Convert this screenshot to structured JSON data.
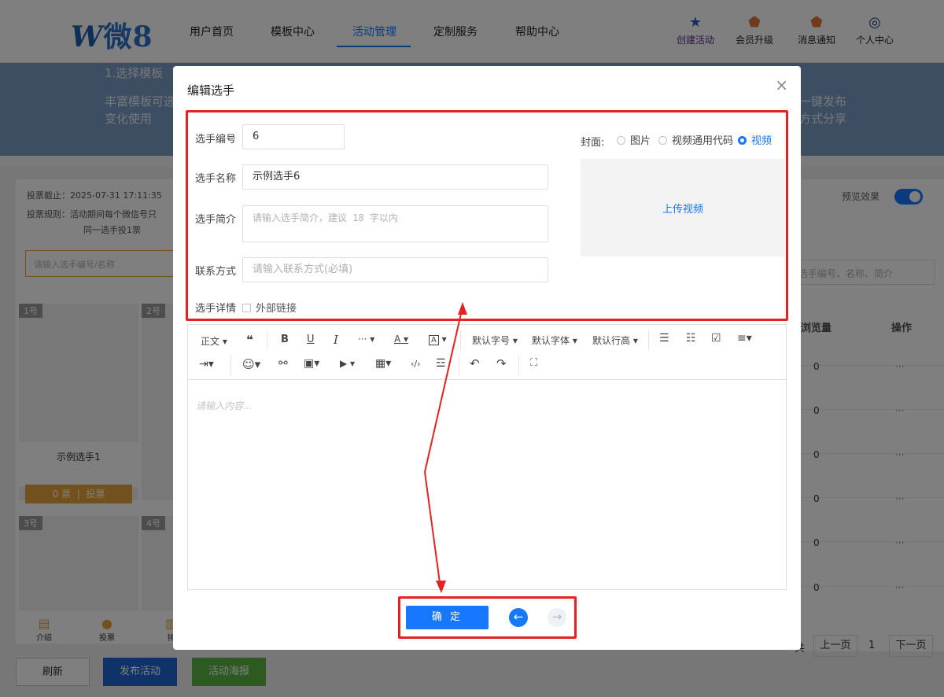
{
  "header": {
    "logo_w": "W",
    "logo_text": "微8",
    "nav": [
      "用户首页",
      "模板中心",
      "活动管理",
      "定制服务",
      "帮助中心"
    ],
    "active_nav": "活动管理",
    "actions": [
      {
        "label": "创建活动",
        "icon": "star-icon"
      },
      {
        "label": "会员升级",
        "icon": "shield-icon"
      },
      {
        "label": "消息通知",
        "icon": "bell-icon"
      },
      {
        "label": "个人中心",
        "icon": "user-icon"
      }
    ]
  },
  "banner": {
    "step1_title": "1.选择模板",
    "step1_desc1": "丰富模板可选",
    "step1_desc2": "变化使用",
    "step4_desc1": "一键发布",
    "step4_desc2": "方式分享"
  },
  "left": {
    "deadline": "投票截止：2025-07-31 17:11:35",
    "rule1": "投票规则：活动期间每个微信号只",
    "rule2": "同一选手投1票",
    "search_placeholder": "请输入选手编号/名称",
    "cards": [
      {
        "tag": "1号",
        "name": "示例选手1",
        "votes": "0 票",
        "vote_btn": "投票"
      },
      {
        "tag": "2号"
      },
      {
        "tag": "3号"
      },
      {
        "tag": "4号"
      }
    ],
    "bottom_nav": [
      "介绍",
      "投票",
      "排"
    ]
  },
  "right": {
    "preview_label": "预览效果",
    "search_placeholder": "选手编号、名称、简介",
    "col_views": "浏览量",
    "col_ops": "操作",
    "rows": [
      "0",
      "0",
      "0",
      "0",
      "0",
      "0"
    ],
    "row_op": "···",
    "pager_prev": "上一页",
    "pager_page": "1",
    "pager_next": "下一页",
    "pager_cut": "共"
  },
  "bottom_buttons": {
    "refresh": "刷新",
    "publish": "发布活动",
    "poster": "活动海报"
  },
  "modal": {
    "title": "编辑选手",
    "close": "×",
    "id_label": "选手编号",
    "id_value": "6",
    "name_label": "选手名称",
    "name_value": "示例选手6",
    "intro_label": "选手简介",
    "intro_placeholder": "请输入选手简介，建议 18 字以内",
    "contact_label": "联系方式",
    "contact_placeholder": "请输入联系方式(必填)",
    "detail_label": "选手详情",
    "external_link": "外部链接",
    "cover_label": "封面:",
    "cover_options": [
      "图片",
      "视频通用代码",
      "视频"
    ],
    "cover_selected": "视频",
    "upload_label": "上传视频",
    "editor_placeholder": "请输入内容...",
    "confirm": "确 定",
    "prev_icon": "arrow-left-icon",
    "next_icon": "arrow-right-icon"
  },
  "toolbar": {
    "paragraph": "正文",
    "quote": "❝",
    "bold": "B",
    "underline": "U",
    "italic": "I",
    "more": "···",
    "font_color": "A",
    "bg_color": "A",
    "font_size": "默认字号",
    "font_family": "默认字体",
    "line_height": "默认行高",
    "bullet_list": "☰",
    "ordered_list": "☷",
    "todo": "☑",
    "align": "≡",
    "indent": "⇥",
    "emoji": "☺",
    "link": "⚯",
    "image": "▣",
    "video": "▶",
    "table": "▦",
    "code": "‹/›",
    "divider": "☲",
    "undo": "↶",
    "redo": "↷",
    "fullscreen": "⛶"
  },
  "colors": {
    "accent": "#1677ff",
    "highlight_red": "#e52222",
    "vote_orange": "#e6a23c",
    "publish_blue": "#1f66d1",
    "poster_green": "#5ab543"
  }
}
